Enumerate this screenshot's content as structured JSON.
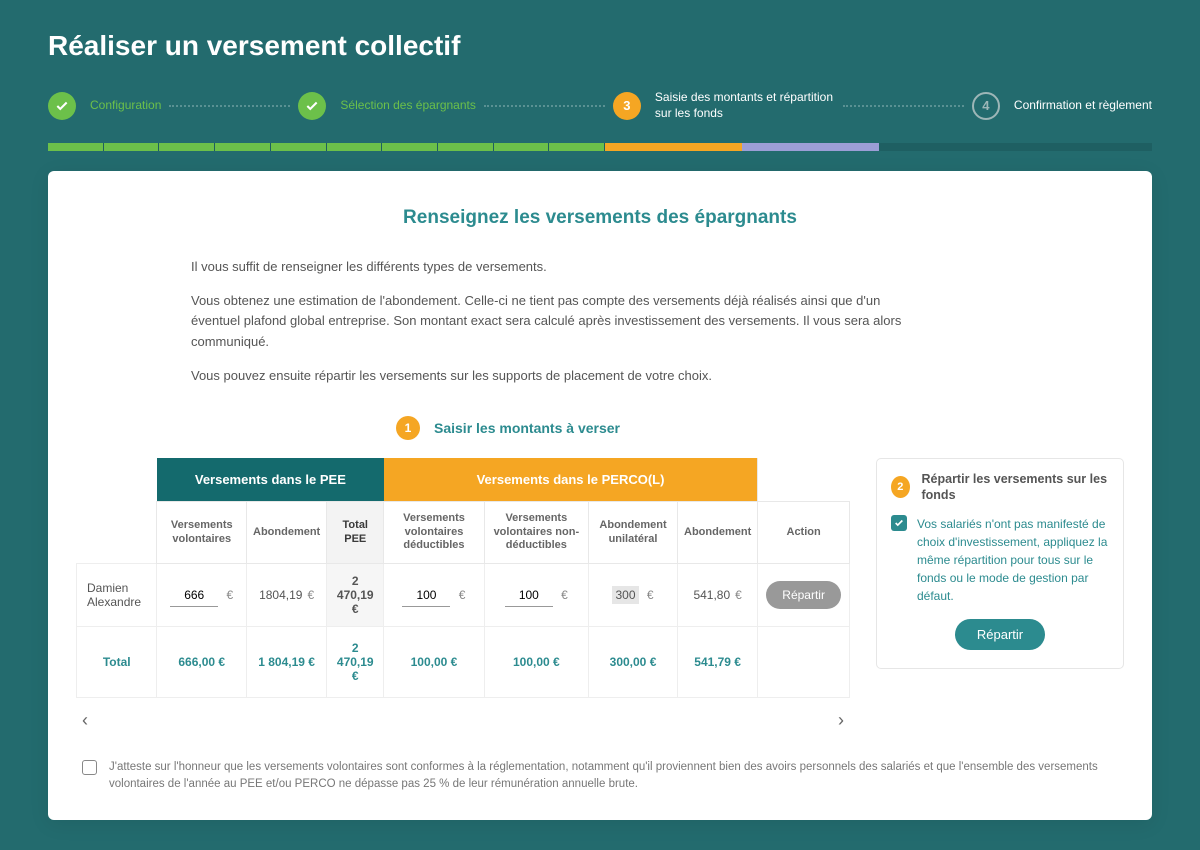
{
  "page_title": "Réaliser un versement collectif",
  "stepper": {
    "steps": [
      {
        "num": "1",
        "label": "Configuration",
        "state": "done"
      },
      {
        "num": "2",
        "label": "Sélection des épargnants",
        "state": "done"
      },
      {
        "num": "3",
        "label": "Saisie des montants et répartition sur les fonds",
        "state": "active"
      },
      {
        "num": "4",
        "label": "Confirmation et règlement",
        "state": "future"
      }
    ]
  },
  "card": {
    "title": "Renseignez les versements des épargnants",
    "intro": [
      "Il vous suffit de renseigner les différents types de versements.",
      "Vous obtenez une estimation de l'abondement. Celle-ci ne tient pas compte des versements déjà réalisés ainsi que d'un éventuel plafond global entreprise. Son montant exact sera calculé après investissement des versements. Il vous sera alors communiqué.",
      "Vous pouvez ensuite répartir les versements sur les supports de placement de votre choix."
    ],
    "substep1": {
      "num": "1",
      "label": "Saisir les montants à verser"
    }
  },
  "table": {
    "group_pee": "Versements dans le PEE",
    "group_perco": "Versements dans le PERCO(L)",
    "cols": {
      "vv": "Versements volontaires",
      "abond": "Abondement",
      "total_pee": "Total PEE",
      "vvd": "Versements volontaires déductibles",
      "vvnd": "Versements volontaires non-déductibles",
      "abond_u": "Abondement unilatéral",
      "abond2": "Abondement",
      "action": "Action"
    },
    "row": {
      "name": "Damien Alexandre",
      "vv": "666",
      "abond": "1804,19",
      "total_pee": "2 470,19 €",
      "vvd": "100",
      "vvnd": "100",
      "abond_u": "300",
      "abond2": "541,80",
      "action_label": "Répartir"
    },
    "totals": {
      "label": "Total",
      "vv": "666,00 €",
      "abond": "1 804,19 €",
      "total_pee": "2 470,19 €",
      "vvd": "100,00 €",
      "vvnd": "100,00 €",
      "abond_u": "300,00 €",
      "abond2": "541,79 €"
    },
    "currency": "€"
  },
  "side": {
    "num": "2",
    "title": "Répartir les versements sur les fonds",
    "text": "Vos salariés n'ont pas manifesté de choix d'investissement, appliquez la même répartition pour tous sur le fonds ou le mode de gestion par défaut.",
    "button": "Répartir"
  },
  "attestation": "J'atteste sur l'honneur que les versements volontaires sont conformes à la réglementation, notamment qu'il proviennent bien des avoirs personnels des salariés et que l'ensemble des versements volontaires de l'année au PEE et/ou PERCO ne dépasse pas 25 % de leur rémunération annuelle brute."
}
